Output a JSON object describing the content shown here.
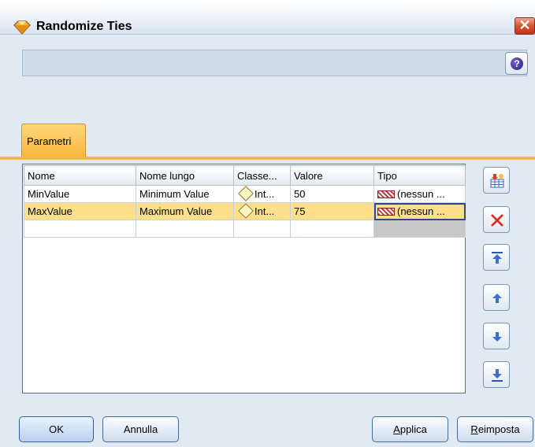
{
  "window": {
    "title": "Randomize Ties",
    "close_glyph": "✕",
    "help_glyph": "?"
  },
  "tabs": [
    {
      "label": "Parametri"
    }
  ],
  "table": {
    "columns": [
      "Nome",
      "Nome lungo",
      "Classe...",
      "Valore",
      "Tipo"
    ],
    "rows": [
      {
        "name": "MinValue",
        "long_name": "Minimum Value",
        "class": "Int...",
        "value": "50",
        "type": "(nessun ..."
      },
      {
        "name": "MaxValue",
        "long_name": "Maximum Value",
        "class": "Int...",
        "value": "75",
        "type": "(nessun ..."
      }
    ]
  },
  "toolbar": {
    "tools": [
      "add-parameter-icon",
      "delete-icon",
      "move-to-top-icon",
      "move-up-icon",
      "move-down-icon",
      "move-to-bottom-icon"
    ]
  },
  "buttons": {
    "ok": "OK",
    "cancel": "Annulla",
    "apply_prefix": "",
    "apply_u": "A",
    "apply_rest": "pplica",
    "reset_u": "R",
    "reset_rest": "eimposta"
  },
  "colors": {
    "accent_tab": "#f7b73d",
    "selected_row": "#ffe08a",
    "close": "#d9532c"
  }
}
